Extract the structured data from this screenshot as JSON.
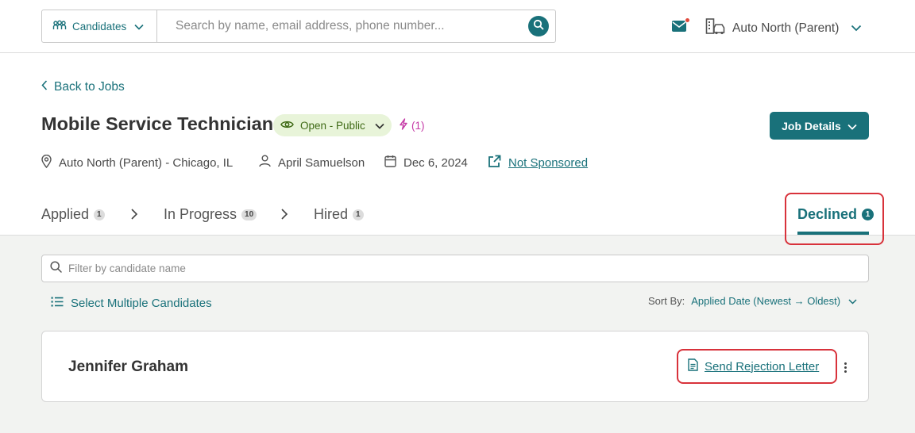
{
  "header": {
    "scope_label": "Candidates",
    "search_placeholder": "Search by name, email address, phone number...",
    "org_label": "Auto North (Parent)",
    "has_unread_mail": true
  },
  "job": {
    "back_label": "Back to Jobs",
    "title": "Mobile Service Technician",
    "status": "Open - Public",
    "boost_count": "(1)",
    "details_button": "Job Details",
    "location": "Auto North (Parent) - Chicago, IL",
    "owner": "April Samuelson",
    "date": "Dec 6, 2024",
    "sponsorship": "Not Sponsored"
  },
  "tabs": [
    {
      "label": "Applied",
      "count": "1",
      "active": false
    },
    {
      "label": "In Progress",
      "count": "10",
      "active": false
    },
    {
      "label": "Hired",
      "count": "1",
      "active": false
    },
    {
      "label": "Declined",
      "count": "1",
      "active": true
    }
  ],
  "list": {
    "filter_placeholder": "Filter by candidate name",
    "select_multiple_label": "Select Multiple Candidates",
    "sort_label": "Sort By:",
    "sort_value": "Applied Date (Newest → Oldest)"
  },
  "candidates": [
    {
      "name": "Jennifer Graham",
      "action_label": "Send Rejection Letter"
    }
  ],
  "colors": {
    "accent": "#19717a",
    "highlight": "#d8323b",
    "status_bg": "#e8f4d9",
    "boost": "#c53aa6"
  }
}
